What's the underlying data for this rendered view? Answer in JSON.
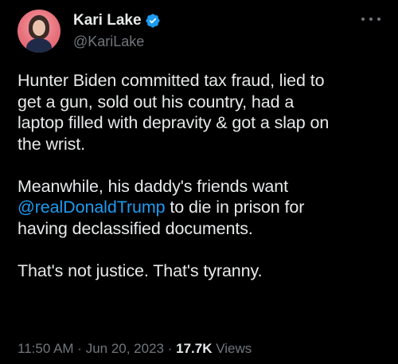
{
  "author": {
    "display_name": "Kari Lake",
    "handle": "@KariLake",
    "verified": true,
    "avatar_icon": "profile-photo"
  },
  "tweet": {
    "line1": "Hunter Biden committed tax fraud, lied to",
    "line2": "get a gun, sold out his country, had a",
    "line3": "laptop filled with depravity & got a slap on",
    "line4": "the wrist.",
    "line5": "Meanwhile, his daddy's friends want",
    "mention": "@realDonaldTrump",
    "line6_rest": " to die in prison for",
    "line7": "having declassified documents.",
    "line8": "That's not justice. That's tyranny."
  },
  "meta": {
    "time": "11:50 AM",
    "sep1": " · ",
    "date": "Jun 20, 2023",
    "sep2": " · ",
    "views_count": "17.7K",
    "views_label": " Views"
  },
  "colors": {
    "background": "#000000",
    "text": "#e7e9ea",
    "secondary": "#71767b",
    "link": "#1d9bf0",
    "verified": "#1d9bf0"
  }
}
